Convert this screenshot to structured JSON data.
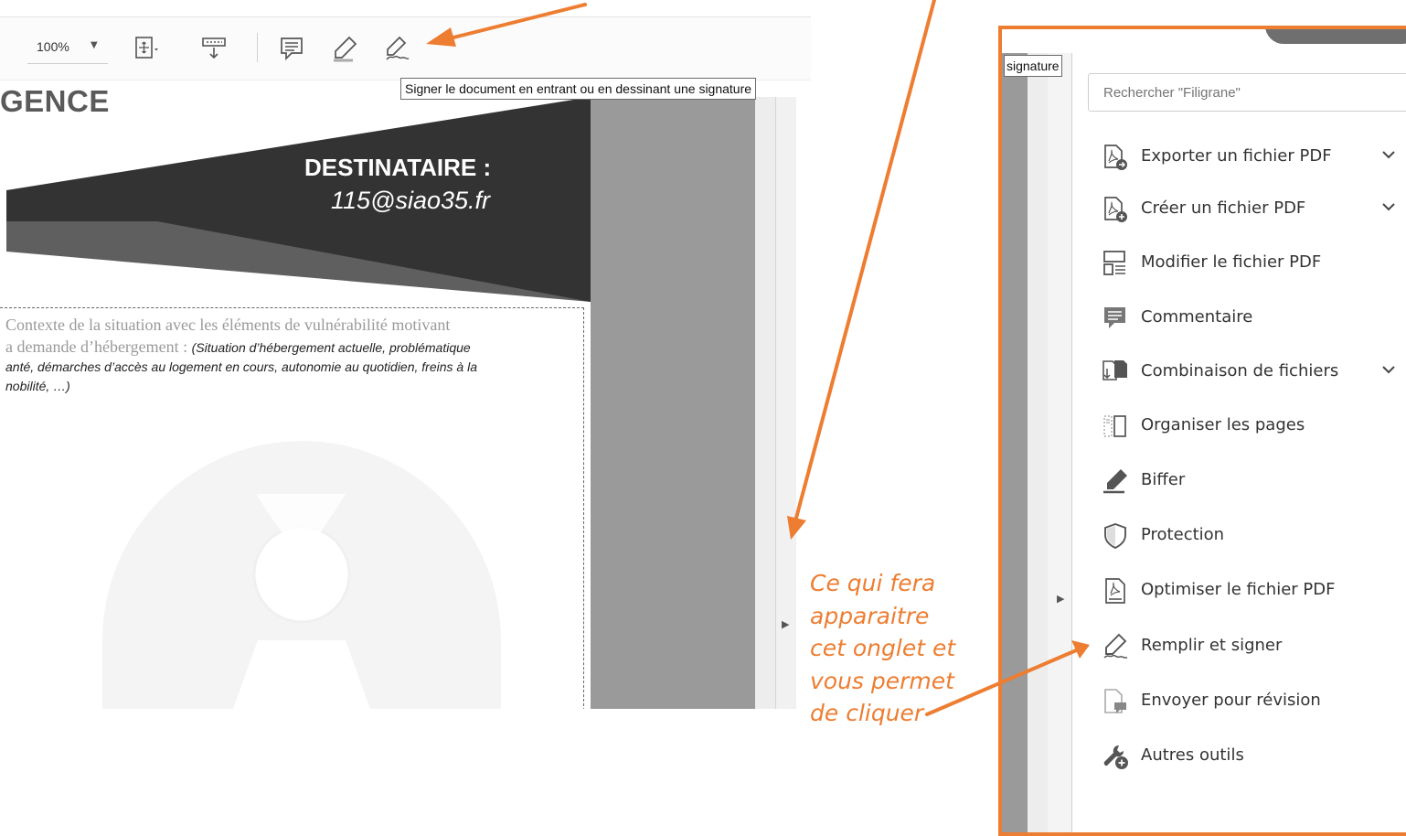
{
  "toolbar": {
    "zoom": "100%",
    "tooltip": "Signer le document en entrant ou en dessinant une signature"
  },
  "document": {
    "heading": "GENCE",
    "recipient_label": "DESTINATAIRE :",
    "recipient_email": "115@siao35.fr",
    "context_line1": "Contexte de la situation avec les éléments de vulnérabilité motivant",
    "context_line2_bold": "a demande d’hébergement : ",
    "context_line2_italic": "(Situation d’hébergement actuelle, problématique",
    "context_line3": "anté, démarches d’accès au logement en cours, autonomie au quotidien, freins à la",
    "context_line4": "nobilité, …)"
  },
  "annotation": {
    "line1": "Ce qui fera",
    "line2": "apparaitre",
    "line3": "cet onglet et",
    "line4": "vous permet",
    "line5": "de cliquer"
  },
  "tools_panel": {
    "signature_label": "signature",
    "search_placeholder": "Rechercher \"Filigrane\"",
    "items": [
      {
        "label": "Exporter un fichier PDF",
        "icon": "export-pdf-icon"
      },
      {
        "label": "Créer un fichier PDF",
        "icon": "create-pdf-icon"
      },
      {
        "label": "Modifier le fichier PDF",
        "icon": "edit-pdf-icon"
      },
      {
        "label": "Commentaire",
        "icon": "comment-icon"
      },
      {
        "label": "Combinaison de fichiers",
        "icon": "combine-files-icon"
      },
      {
        "label": "Organiser les pages",
        "icon": "organize-pages-icon"
      },
      {
        "label": "Biffer",
        "icon": "redact-icon"
      },
      {
        "label": "Protection",
        "icon": "shield-icon"
      },
      {
        "label": "Optimiser le fichier PDF",
        "icon": "optimize-pdf-icon"
      },
      {
        "label": "Remplir et signer",
        "icon": "fill-sign-icon"
      },
      {
        "label": "Envoyer pour révision",
        "icon": "send-review-icon"
      },
      {
        "label": "Autres outils",
        "icon": "more-tools-icon"
      }
    ]
  },
  "colors": {
    "accent": "#ed7d31",
    "banner_dark": "#333333",
    "banner_mid": "#5f5f5f",
    "side_gray": "#9a9a9a"
  }
}
